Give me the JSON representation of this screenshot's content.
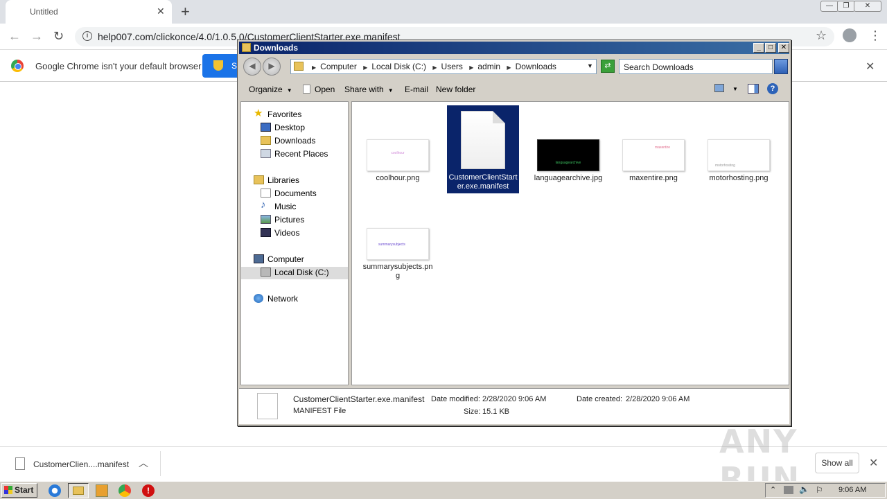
{
  "chrome": {
    "tab_title": "Untitled",
    "url": "help007.com/clickonce/4.0/1.0.5.0/CustomerClientStarter.exe.manifest",
    "infobar_text": "Google Chrome isn't your default browser",
    "infobar_button_label": "S"
  },
  "download_shelf": {
    "file_name": "CustomerClien....manifest",
    "show_all": "Show all"
  },
  "explorer": {
    "title": "Downloads",
    "breadcrumb": [
      "Computer",
      "Local Disk (C:)",
      "Users",
      "admin",
      "Downloads"
    ],
    "search_placeholder": "Search Downloads",
    "commands": {
      "organize": "Organize",
      "open": "Open",
      "share_with": "Share with",
      "email": "E-mail",
      "new_folder": "New folder"
    },
    "nav": {
      "favorites": "Favorites",
      "desktop": "Desktop",
      "downloads": "Downloads",
      "recent_places": "Recent Places",
      "libraries": "Libraries",
      "documents": "Documents",
      "music": "Music",
      "pictures": "Pictures",
      "videos": "Videos",
      "computer": "Computer",
      "local_disk": "Local Disk (C:)",
      "network": "Network"
    },
    "files": [
      {
        "name": "coolhour.png",
        "thumb_text": "coolhour"
      },
      {
        "name": "CustomerClientStarter.exe.manifest",
        "thumb_text": ""
      },
      {
        "name": "languagearchive.jpg",
        "thumb_text": "languagearchive"
      },
      {
        "name": "maxentire.png",
        "thumb_text": "maxentire"
      },
      {
        "name": "motorhosting.png",
        "thumb_text": "motorhosting"
      },
      {
        "name": "summarysubjects.png",
        "thumb_text": "summarysubjects"
      }
    ],
    "details": {
      "file_name": "CustomerClientStarter.exe.manifest",
      "file_type": "MANIFEST File",
      "date_modified_label": "Date modified:",
      "date_modified": "2/28/2020 9:06 AM",
      "date_created_label": "Date created:",
      "date_created": "2/28/2020 9:06 AM",
      "size_label": "Size:",
      "size": "15.1 KB"
    }
  },
  "taskbar": {
    "start_label": "Start",
    "clock": "9:06 AM"
  },
  "watermark": "ANY RUN"
}
